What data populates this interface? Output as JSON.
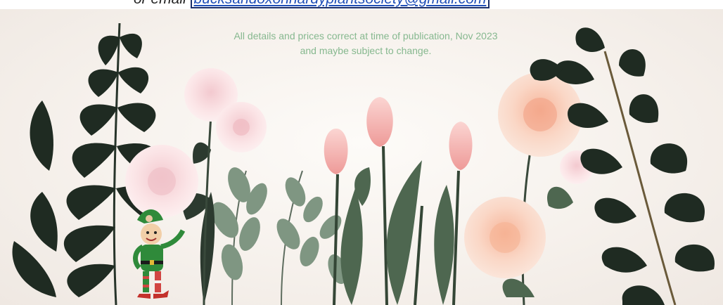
{
  "header": {
    "prefix": "or email ",
    "email": "bucksandoxonhardyplantsociety@gmail.com"
  },
  "notice": {
    "line1": "All details and prices correct at time of publication, Nov 2023",
    "line2": "and maybe subject to change."
  },
  "colors": {
    "notice_text": "#86b88f",
    "email_link": "#1f4fb8",
    "leaf_dark": "#1f2b22",
    "leaf_sage": "#7f9682",
    "rose": "#f6c6b0",
    "tulip": "#f2a5a3",
    "elf_green": "#2f8a3a"
  },
  "icons": [
    "fern-leaf-icon",
    "rose-icon",
    "tulip-icon",
    "elf-icon"
  ]
}
